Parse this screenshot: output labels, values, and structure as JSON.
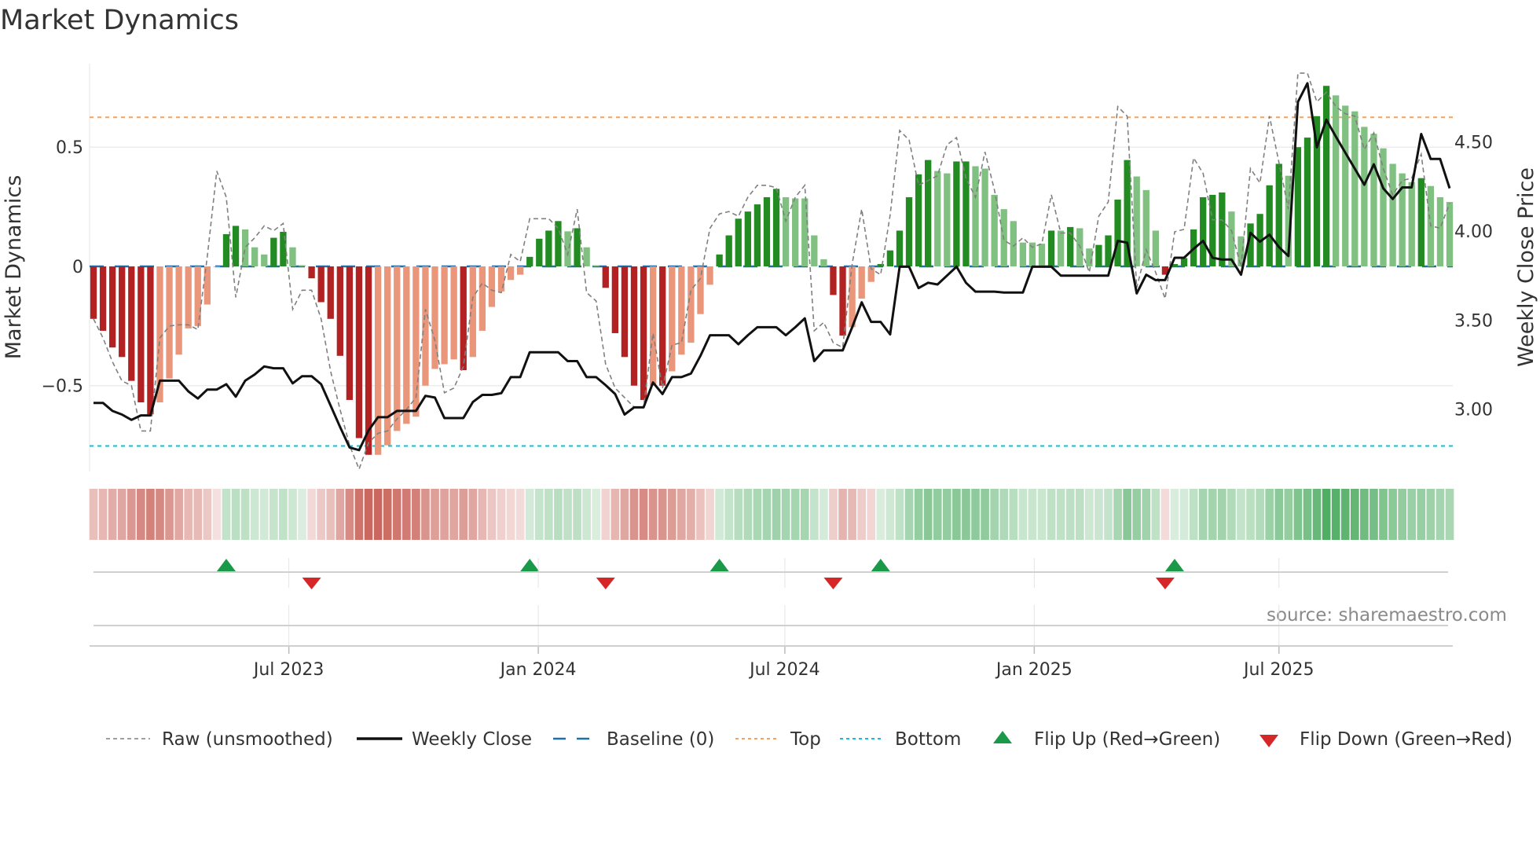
{
  "chart_data": {
    "type": "bar",
    "title": "Market Dynamics",
    "ylabel": "Market Dynamics",
    "y2label": "Weekly Close Price",
    "source": "source: sharemaestro.com",
    "ylim": [
      -0.86,
      0.85
    ],
    "y2lim": [
      2.65,
      4.94
    ],
    "yticks": [
      {
        "v": 0.5,
        "label": "0.5"
      },
      {
        "v": 0,
        "label": "0"
      },
      {
        "v": -0.5,
        "label": "−0.5"
      }
    ],
    "y2ticks": [
      {
        "v": 3.0,
        "label": "3.00"
      },
      {
        "v": 3.5,
        "label": "3.50"
      },
      {
        "v": 4.0,
        "label": "4.00"
      },
      {
        "v": 4.5,
        "label": "4.50"
      }
    ],
    "x_unit": "week index",
    "xticks": [
      {
        "x": 20.6,
        "label": "Jul 2023"
      },
      {
        "x": 46.9,
        "label": "Jan 2024"
      },
      {
        "x": 72.9,
        "label": "Jul 2024"
      },
      {
        "x": 99.2,
        "label": "Jan 2025"
      },
      {
        "x": 125.0,
        "label": "Jul 2025"
      }
    ],
    "top_level": 0.625,
    "bottom_level": -0.753,
    "baseline": 0,
    "colors": {
      "strong_red": "#b22222",
      "weak_red": "#e9967a",
      "strong_green": "#228b22",
      "weak_green": "#80c080",
      "raw": "#808080",
      "close": "#111111",
      "baseline": "#1f6fa8",
      "top": "#f4a460",
      "bottom": "#17becf",
      "flip_up": "#1a9a48",
      "flip_down": "#d62728"
    },
    "smoothed": [
      -0.22,
      -0.27,
      -0.34,
      -0.38,
      -0.48,
      -0.57,
      -0.62,
      -0.57,
      -0.47,
      -0.37,
      -0.26,
      -0.25,
      -0.16,
      -0.003,
      0.135,
      0.17,
      0.155,
      0.08,
      0.05,
      0.12,
      0.145,
      0.08,
      0.005,
      -0.05,
      -0.15,
      -0.22,
      -0.375,
      -0.56,
      -0.72,
      -0.79,
      -0.79,
      -0.75,
      -0.69,
      -0.66,
      -0.63,
      -0.5,
      -0.43,
      -0.41,
      -0.39,
      -0.435,
      -0.38,
      -0.27,
      -0.17,
      -0.105,
      -0.057,
      -0.035,
      0.04,
      0.116,
      0.15,
      0.19,
      0.147,
      0.16,
      0.08,
      0.003,
      -0.09,
      -0.28,
      -0.38,
      -0.5,
      -0.56,
      -0.5,
      -0.5,
      -0.44,
      -0.37,
      -0.32,
      -0.2,
      -0.077,
      0.05,
      0.13,
      0.2,
      0.23,
      0.26,
      0.29,
      0.325,
      0.29,
      0.285,
      0.285,
      0.13,
      0.03,
      -0.12,
      -0.29,
      -0.255,
      -0.135,
      -0.065,
      0.01,
      0.067,
      0.15,
      0.29,
      0.386,
      0.446,
      0.4,
      0.39,
      0.44,
      0.44,
      0.42,
      0.41,
      0.3,
      0.24,
      0.19,
      0.1,
      0.1,
      0.095,
      0.15,
      0.15,
      0.165,
      0.16,
      0.075,
      0.09,
      0.13,
      0.28,
      0.446,
      0.377,
      0.32,
      0.15,
      -0.035,
      0.01,
      0.035,
      0.155,
      0.29,
      0.3,
      0.31,
      0.23,
      0.126,
      0.18,
      0.22,
      0.34,
      0.43,
      0.38,
      0.5,
      0.54,
      0.63,
      0.757,
      0.717,
      0.674,
      0.65,
      0.585,
      0.556,
      0.495,
      0.43,
      0.39,
      0.353,
      0.37,
      0.337,
      0.29,
      0.27
    ],
    "strengthening": [
      1,
      1,
      1,
      1,
      1,
      1,
      1,
      0,
      0,
      0,
      0,
      0,
      0,
      0,
      1,
      1,
      0,
      0,
      0,
      1,
      1,
      0,
      0,
      1,
      1,
      1,
      1,
      1,
      1,
      1,
      0,
      0,
      0,
      0,
      0,
      0,
      0,
      0,
      0,
      1,
      0,
      0,
      0,
      0,
      0,
      0,
      1,
      1,
      1,
      1,
      0,
      1,
      0,
      0,
      1,
      1,
      1,
      1,
      1,
      0,
      1,
      0,
      0,
      0,
      0,
      0,
      1,
      1,
      1,
      1,
      1,
      1,
      1,
      0,
      0,
      0,
      0,
      0,
      1,
      1,
      0,
      0,
      0,
      1,
      1,
      1,
      1,
      1,
      1,
      0,
      0,
      1,
      1,
      0,
      0,
      0,
      0,
      0,
      0,
      0,
      0,
      1,
      0,
      1,
      0,
      0,
      1,
      1,
      1,
      1,
      0,
      0,
      0,
      1,
      1,
      1,
      1,
      1,
      1,
      1,
      0,
      0,
      1,
      1,
      1,
      1,
      0,
      1,
      1,
      1,
      1,
      0,
      0,
      0,
      0,
      0,
      0,
      0,
      0,
      0,
      1,
      0,
      0,
      0
    ],
    "raw": [
      -0.22,
      -0.3,
      -0.4,
      -0.48,
      -0.5,
      -0.69,
      -0.69,
      -0.3,
      -0.25,
      -0.245,
      -0.245,
      -0.265,
      0.04,
      0.4,
      0.29,
      -0.13,
      0.08,
      0.12,
      0.17,
      0.15,
      0.18,
      -0.18,
      -0.1,
      -0.1,
      -0.22,
      -0.44,
      -0.6,
      -0.75,
      -0.85,
      -0.74,
      -0.7,
      -0.69,
      -0.64,
      -0.6,
      -0.55,
      -0.18,
      -0.31,
      -0.53,
      -0.51,
      -0.42,
      -0.13,
      -0.07,
      -0.1,
      -0.11,
      0.05,
      0.02,
      0.2,
      0.2,
      0.2,
      0.16,
      0.05,
      0.24,
      -0.11,
      -0.145,
      -0.41,
      -0.51,
      -0.55,
      -0.59,
      -0.59,
      -0.28,
      -0.51,
      -0.33,
      -0.32,
      -0.1,
      -0.05,
      0.16,
      0.22,
      0.23,
      0.21,
      0.29,
      0.34,
      0.34,
      0.33,
      0.19,
      0.29,
      0.34,
      -0.27,
      -0.235,
      -0.32,
      -0.34,
      0.01,
      0.24,
      -0.01,
      -0.035,
      0.215,
      0.57,
      0.53,
      0.34,
      0.36,
      0.38,
      0.51,
      0.54,
      0.37,
      0.29,
      0.48,
      0.32,
      0.11,
      0.085,
      0.12,
      0.08,
      0.095,
      0.3,
      0.14,
      0.14,
      0.085,
      -0.025,
      0.21,
      0.27,
      0.67,
      0.63,
      -0.09,
      0.07,
      -0.025,
      -0.135,
      0.145,
      0.155,
      0.455,
      0.39,
      0.195,
      0.195,
      0.15,
      -0.003,
      0.41,
      0.35,
      0.63,
      0.435,
      0.24,
      0.81,
      0.81,
      0.69,
      0.73,
      0.67,
      0.64,
      0.63,
      0.49,
      0.56,
      0.41,
      0.3,
      0.36,
      0.37,
      0.47,
      0.17,
      0.16,
      0.265
    ],
    "close": [
      3.035,
      3.035,
      2.99,
      2.97,
      2.94,
      2.965,
      2.965,
      3.16,
      3.16,
      3.16,
      3.1,
      3.06,
      3.11,
      3.11,
      3.14,
      3.07,
      3.16,
      3.195,
      3.24,
      3.23,
      3.23,
      3.145,
      3.185,
      3.185,
      3.14,
      3.02,
      2.9,
      2.785,
      2.77,
      2.88,
      2.955,
      2.955,
      2.99,
      2.99,
      2.99,
      3.075,
      3.065,
      2.95,
      2.95,
      2.95,
      3.04,
      3.08,
      3.08,
      3.09,
      3.18,
      3.18,
      3.32,
      3.32,
      3.32,
      3.32,
      3.27,
      3.27,
      3.18,
      3.18,
      3.135,
      3.085,
      2.97,
      3.01,
      3.01,
      3.15,
      3.085,
      3.18,
      3.18,
      3.2,
      3.3,
      3.415,
      3.415,
      3.415,
      3.365,
      3.415,
      3.46,
      3.46,
      3.46,
      3.415,
      3.46,
      3.51,
      3.27,
      3.33,
      3.33,
      3.33,
      3.46,
      3.6,
      3.49,
      3.49,
      3.42,
      3.8,
      3.8,
      3.68,
      3.71,
      3.7,
      3.75,
      3.8,
      3.71,
      3.66,
      3.66,
      3.66,
      3.655,
      3.655,
      3.655,
      3.8,
      3.8,
      3.8,
      3.75,
      3.75,
      3.75,
      3.75,
      3.75,
      3.75,
      3.945,
      3.935,
      3.65,
      3.755,
      3.725,
      3.725,
      3.85,
      3.85,
      3.9,
      3.945,
      3.85,
      3.84,
      3.84,
      3.755,
      3.99,
      3.94,
      3.98,
      3.91,
      3.86,
      4.725,
      4.83,
      4.47,
      4.625,
      4.53,
      4.44,
      4.35,
      4.26,
      4.375,
      4.24,
      4.18,
      4.245,
      4.245,
      4.545,
      4.405,
      4.405,
      4.24
    ],
    "flip_up_weeks": [
      14,
      46,
      66,
      83,
      114
    ],
    "flip_down_weeks": [
      23,
      54,
      78,
      113
    ],
    "legend": {
      "placement": "bottom",
      "items": [
        {
          "key": "raw",
          "label": "Raw (unsmoothed)"
        },
        {
          "key": "close",
          "label": "Weekly Close"
        },
        {
          "key": "baseline",
          "label": "Baseline (0)"
        },
        {
          "key": "top",
          "label": "Top"
        },
        {
          "key": "bottom",
          "label": "Bottom"
        },
        {
          "key": "flip_up",
          "label": "Flip Up (Red→Green)"
        },
        {
          "key": "flip_down",
          "label": "Flip Down (Green→Red)"
        }
      ]
    }
  }
}
